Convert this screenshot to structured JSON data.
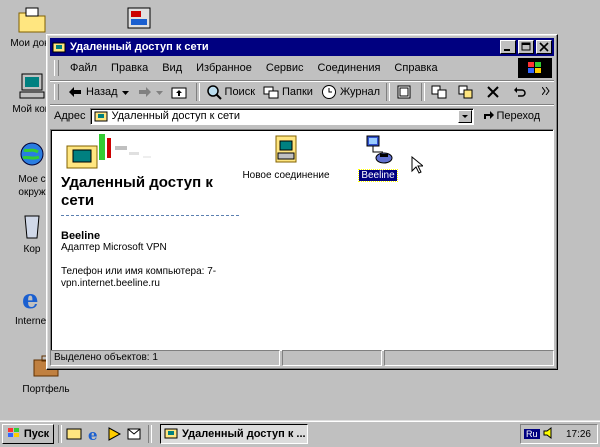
{
  "desktop": {
    "icons": [
      {
        "label": "Мои доку",
        "icon": "folder-icon"
      },
      {
        "label": "Мой ком",
        "icon": "computer-icon"
      },
      {
        "label": "Мое с",
        "icon": "network-icon"
      },
      {
        "label": "окруж",
        "icon": "network-icon"
      },
      {
        "label": "Кор",
        "icon": "recycle-bin-icon"
      },
      {
        "label": "Internet",
        "icon": "ie-icon"
      },
      {
        "label": "Портфель",
        "icon": "briefcase-icon"
      }
    ]
  },
  "window": {
    "title": "Удаленный доступ к сети",
    "menu": [
      "Файл",
      "Правка",
      "Вид",
      "Избранное",
      "Сервис",
      "Соединения",
      "Справка"
    ],
    "toolbar": {
      "back": "Назад",
      "search": "Поиск",
      "folders": "Папки",
      "history": "Журнал"
    },
    "address": {
      "label": "Адрес",
      "value": "Удаленный доступ к сети",
      "go": "Переход"
    },
    "panel": {
      "title": "Удаленный доступ к сети",
      "name": "Beeline",
      "adapter": "Адаптер Microsoft VPN",
      "phone_line1": "Телефон или имя компьютера: 7-",
      "phone_line2": "vpn.internet.beeline.ru"
    },
    "items": [
      {
        "label": "Новое соединение",
        "icon": "new-connection-icon"
      },
      {
        "label": "Beeline",
        "icon": "dialup-connection-icon",
        "selected": true
      }
    ],
    "status": "Выделено объектов: 1"
  },
  "taskbar": {
    "start": "Пуск",
    "task": "Удаленный доступ к ...",
    "lang": "Ru",
    "clock": "17:26"
  },
  "colors": {
    "desktop": "#c0c0c0",
    "titlebar": "#000080",
    "selection": "#000080"
  }
}
